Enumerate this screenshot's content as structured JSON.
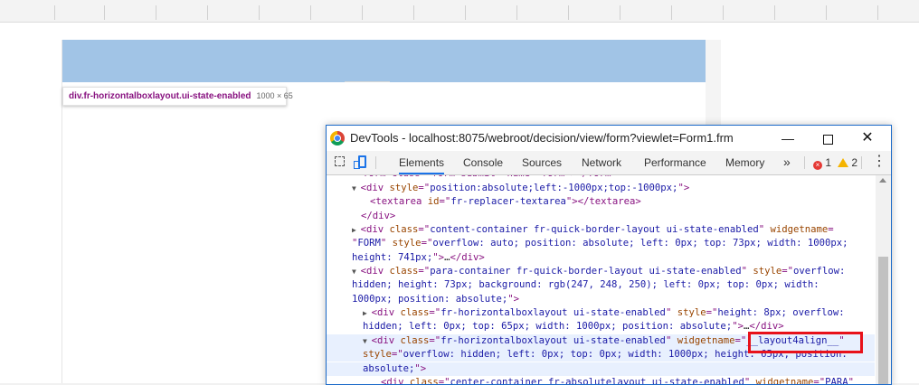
{
  "tooltip": {
    "selector": "div.fr-horizontalboxlayout.ui-state-enabled",
    "size": "1000 × 65"
  },
  "devtools": {
    "title": "DevTools - localhost:8075/webroot/decision/view/form?viewlet=Form1.frm",
    "window_controls": {
      "minimize": "—",
      "close": "✕"
    },
    "tabs": [
      "Elements",
      "Console",
      "Sources",
      "Network",
      "Performance",
      "Memory"
    ],
    "active_tab": "Elements",
    "more_tabs": "»",
    "errors": "1",
    "warnings": "2",
    "menu": "⋮"
  },
  "code_lines": [
    {
      "tokens": [
        {
          "t": "tag",
          "v": "form class=\"form-submit\" name=\"form\"></form>"
        }
      ]
    },
    {
      "tokens": [
        {
          "t": "tri",
          "v": "▼"
        },
        {
          "t": "tag",
          "v": "<div "
        },
        {
          "t": "an",
          "v": "style"
        },
        {
          "t": "tag",
          "v": "=\""
        },
        {
          "t": "av",
          "v": "position:absolute;left:-1000px;top:-1000px;"
        },
        {
          "t": "tag",
          "v": "\">"
        }
      ]
    },
    {
      "tokens": [
        {
          "t": "tag",
          "v": "<textarea "
        },
        {
          "t": "an",
          "v": "id"
        },
        {
          "t": "tag",
          "v": "=\""
        },
        {
          "t": "av",
          "v": "fr-replacer-textarea"
        },
        {
          "t": "tag",
          "v": "\"></textarea>"
        }
      ]
    },
    {
      "tokens": [
        {
          "t": "tag",
          "v": "</div>"
        }
      ]
    },
    {
      "tokens": [
        {
          "t": "tri",
          "v": "▶"
        },
        {
          "t": "tag",
          "v": "<div "
        },
        {
          "t": "an",
          "v": "class"
        },
        {
          "t": "tag",
          "v": "=\""
        },
        {
          "t": "av",
          "v": "content-container fr-quick-border-layout ui-state-enabled"
        },
        {
          "t": "tag",
          "v": "\" "
        },
        {
          "t": "an",
          "v": "widgetname"
        },
        {
          "t": "tag",
          "v": "="
        }
      ]
    },
    {
      "tokens": [
        {
          "t": "tag",
          "v": "\""
        },
        {
          "t": "av",
          "v": "FORM"
        },
        {
          "t": "tag",
          "v": "\" "
        },
        {
          "t": "an",
          "v": "style"
        },
        {
          "t": "tag",
          "v": "=\""
        },
        {
          "t": "av",
          "v": "overflow: auto; position: absolute; left: 0px; top: 73px; width: 1000px;"
        }
      ]
    },
    {
      "tokens": [
        {
          "t": "av",
          "v": "height: 741px;"
        },
        {
          "t": "tag",
          "v": "\">"
        },
        {
          "t": "tx",
          "v": "…"
        },
        {
          "t": "tag",
          "v": "</div>"
        }
      ]
    },
    {
      "tokens": [
        {
          "t": "tri",
          "v": "▼"
        },
        {
          "t": "tag",
          "v": "<div "
        },
        {
          "t": "an",
          "v": "class"
        },
        {
          "t": "tag",
          "v": "=\""
        },
        {
          "t": "av",
          "v": "para-container fr-quick-border-layout ui-state-enabled"
        },
        {
          "t": "tag",
          "v": "\" "
        },
        {
          "t": "an",
          "v": "style"
        },
        {
          "t": "tag",
          "v": "=\""
        },
        {
          "t": "av",
          "v": "overflow:"
        }
      ]
    },
    {
      "tokens": [
        {
          "t": "av",
          "v": "hidden; height: 73px; background: rgb(247, 248, 250); left: 0px; top: 0px; width:"
        }
      ]
    },
    {
      "tokens": [
        {
          "t": "av",
          "v": "1000px; position: absolute;"
        },
        {
          "t": "tag",
          "v": "\">"
        }
      ]
    },
    {
      "tokens": [
        {
          "t": "tri",
          "v": "▶"
        },
        {
          "t": "tag",
          "v": "<div "
        },
        {
          "t": "an",
          "v": "class"
        },
        {
          "t": "tag",
          "v": "=\""
        },
        {
          "t": "av",
          "v": "fr-horizontalboxlayout ui-state-enabled"
        },
        {
          "t": "tag",
          "v": "\" "
        },
        {
          "t": "an",
          "v": "style"
        },
        {
          "t": "tag",
          "v": "=\""
        },
        {
          "t": "av",
          "v": "height: 8px; overflow:"
        }
      ]
    },
    {
      "tokens": [
        {
          "t": "av",
          "v": "hidden; left: 0px; top: 65px; width: 1000px; position: absolute;"
        },
        {
          "t": "tag",
          "v": "\">"
        },
        {
          "t": "tx",
          "v": "…"
        },
        {
          "t": "tag",
          "v": "</div>"
        }
      ]
    },
    {
      "tokens": [
        {
          "t": "tri",
          "v": "▼"
        },
        {
          "t": "tag",
          "v": "<div "
        },
        {
          "t": "an",
          "v": "class"
        },
        {
          "t": "tag",
          "v": "=\""
        },
        {
          "t": "av",
          "v": "fr-horizontalboxlayout ui-state-enabled"
        },
        {
          "t": "tag",
          "v": "\" "
        },
        {
          "t": "an",
          "v": "widgetname"
        },
        {
          "t": "tag",
          "v": "=\""
        },
        {
          "t": "av",
          "v": "__layout4align__"
        },
        {
          "t": "tag",
          "v": "\""
        }
      ]
    },
    {
      "tokens": [
        {
          "t": "an",
          "v": "style"
        },
        {
          "t": "tag",
          "v": "=\""
        },
        {
          "t": "av",
          "v": "overflow: hidden; left: 0px; top: 0px; width: 1000px; height: 65px; position:"
        }
      ]
    },
    {
      "tokens": [
        {
          "t": "av",
          "v": "absolute;"
        },
        {
          "t": "tag",
          "v": "\">"
        }
      ]
    },
    {
      "tokens": [
        {
          "t": "tag",
          "v": "<div "
        },
        {
          "t": "an",
          "v": "class"
        },
        {
          "t": "tag",
          "v": "=\""
        },
        {
          "t": "av",
          "v": "center-container fr-absolutelayout ui-state-enabled"
        },
        {
          "t": "tag",
          "v": "\" "
        },
        {
          "t": "an",
          "v": "widgetname"
        },
        {
          "t": "tag",
          "v": "=\""
        },
        {
          "t": "av",
          "v": "PARA"
        },
        {
          "t": "tag",
          "v": "\""
        }
      ]
    }
  ],
  "colors": {
    "highlight": "#a1c4e6",
    "selection": "#e8f0fe",
    "redbox": "#e8111a",
    "accent": "#1a73e8"
  },
  "icons": [
    "chrome-icon",
    "inspect-icon",
    "device-toolbar-icon",
    "error-icon",
    "warning-icon",
    "kebab-menu-icon",
    "expand-triangle-icon",
    "collapse-triangle-icon"
  ]
}
